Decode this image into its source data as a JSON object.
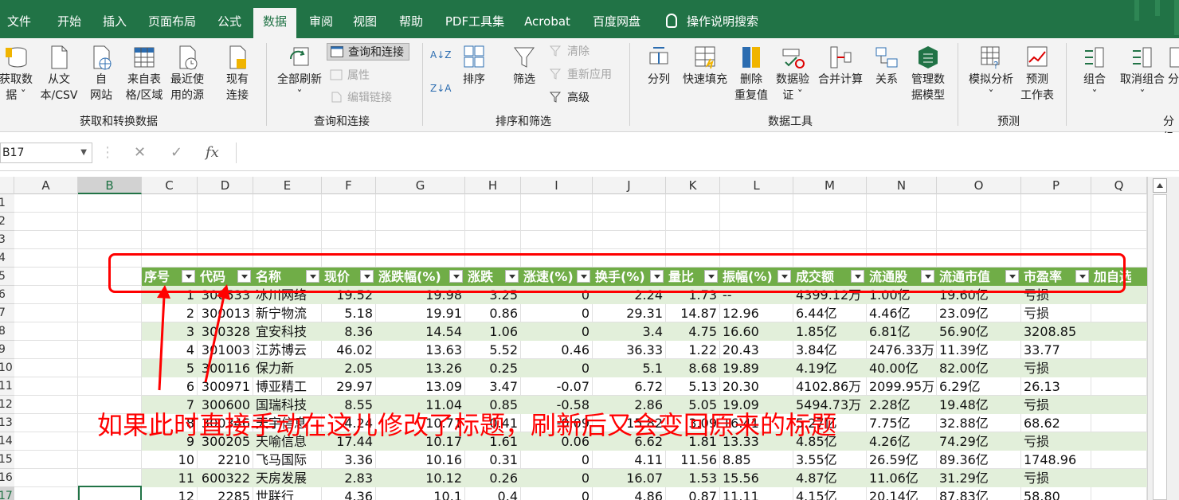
{
  "ribbon_tabs": [
    "文件",
    "开始",
    "插入",
    "页面布局",
    "公式",
    "数据",
    "审阅",
    "视图",
    "帮助",
    "PDF工具集",
    "Acrobat",
    "百度网盘"
  ],
  "active_tab": "数据",
  "tell_me": "操作说明搜索",
  "ribbon": {
    "get_data": "获取数\n据 ˇ",
    "from_text": "从文\n本/CSV",
    "from_web": "自\n网站",
    "from_table": "来自表\n格/区域",
    "recent_sources": "最近使\n用的源",
    "existing_conn": "现有\n连接",
    "group_get": "获取和转换数据",
    "refresh_all": "全部刷新\nˇ",
    "queries_conn": "查询和连接",
    "properties": "属性",
    "edit_links": "编辑链接",
    "group_queries": "查询和连接",
    "sort_az": "A↓Z",
    "sort_za": "Z↓A",
    "sort": "排序",
    "filter": "筛选",
    "clear": "清除",
    "reapply": "重新应用",
    "advanced": "高级",
    "group_sort": "排序和筛选",
    "text_to_columns": "分列",
    "flash_fill": "快速填充",
    "remove_dup": "删除\n重复值",
    "data_validation": "数据验\n证 ˇ",
    "consolidate": "合并计算",
    "relationships": "关系",
    "data_model": "管理数\n据模型",
    "group_tools": "数据工具",
    "what_if": "模拟分析\nˇ",
    "forecast_sheet": "预测\n工作表",
    "group_forecast": "预测",
    "group_btn": "组合\nˇ",
    "ungroup": "取消组合\nˇ",
    "subtotal": "分",
    "group_outline": "分级"
  },
  "formula_bar": {
    "name_box": "B17",
    "fx": "fx",
    "cancel": "✕",
    "enter": "✓"
  },
  "columns": [
    "A",
    "B",
    "C",
    "D",
    "E",
    "F",
    "G",
    "H",
    "I",
    "J",
    "K",
    "L",
    "M",
    "N",
    "O",
    "P",
    "Q"
  ],
  "row_numbers": [
    "1",
    "2",
    "3",
    "4",
    "5",
    "6",
    "7",
    "8",
    "9",
    "10",
    "11",
    "12",
    "13",
    "14",
    "15",
    "16",
    "17"
  ],
  "table": {
    "headers": [
      "序号",
      "代码",
      "名称",
      "现价",
      "涨跌幅(%)",
      "涨跌",
      "涨速(%)",
      "换手(%)",
      "量比",
      "振幅(%)",
      "成交额",
      "流通股",
      "流通市值",
      "市盈率",
      "加自选"
    ],
    "rows": [
      [
        "1",
        "300533",
        "冰川网络",
        "19.52",
        "19.98",
        "3.25",
        "0",
        "2.24",
        "1.73",
        "--",
        "4399.12万",
        "1.00亿",
        "19.60亿",
        "亏损"
      ],
      [
        "2",
        "300013",
        "新宁物流",
        "5.18",
        "19.91",
        "0.86",
        "0",
        "29.31",
        "14.87",
        "12.96",
        "6.44亿",
        "4.46亿",
        "23.09亿",
        "亏损"
      ],
      [
        "3",
        "300328",
        "宜安科技",
        "8.36",
        "14.54",
        "1.06",
        "0",
        "3.4",
        "4.75",
        "16.60",
        "1.85亿",
        "6.81亿",
        "56.90亿",
        "3208.85"
      ],
      [
        "4",
        "301003",
        "江苏博云",
        "46.02",
        "13.63",
        "5.52",
        "0.46",
        "36.33",
        "1.22",
        "20.43",
        "3.84亿",
        "2476.33万",
        "11.39亿",
        "33.77"
      ],
      [
        "5",
        "300116",
        "保力新",
        "2.05",
        "13.26",
        "0.25",
        "0",
        "5.1",
        "8.68",
        "19.89",
        "4.19亿",
        "40.00亿",
        "82.00亿",
        "亏损"
      ],
      [
        "6",
        "300971",
        "博亚精工",
        "29.97",
        "13.09",
        "3.47",
        "-0.07",
        "6.72",
        "5.13",
        "20.30",
        "4102.86万",
        "2099.95万",
        "6.29亿",
        "26.13"
      ],
      [
        "7",
        "300600",
        "国瑞科技",
        "8.55",
        "11.04",
        "0.85",
        "-0.58",
        "2.86",
        "5.05",
        "19.09",
        "5494.73万",
        "2.28亿",
        "19.48亿",
        "亏损"
      ],
      [
        "8",
        "300346",
        "天宇信息",
        "4.24",
        "10.71",
        "0.41",
        "-0.09",
        "15.82",
        "3.09",
        "16.41",
        "5.27亿",
        "7.75亿",
        "32.88亿",
        "68.62"
      ],
      [
        "9",
        "300205",
        "天喻信息",
        "17.44",
        "10.17",
        "1.61",
        "0.06",
        "6.62",
        "1.81",
        "13.33",
        "4.85亿",
        "4.26亿",
        "74.29亿",
        "亏损"
      ],
      [
        "10",
        "2210",
        "飞马国际",
        "3.36",
        "10.16",
        "0.31",
        "0",
        "4.11",
        "11.56",
        "8.85",
        "3.55亿",
        "26.59亿",
        "89.36亿",
        "1748.96"
      ],
      [
        "11",
        "600322",
        "天房发展",
        "2.83",
        "10.12",
        "0.26",
        "0",
        "16.07",
        "1.53",
        "15.56",
        "4.87亿",
        "11.06亿",
        "31.29亿",
        "亏损"
      ],
      [
        "12",
        "2285",
        "世联行",
        "4.36",
        "10.1",
        "0.4",
        "0",
        "4.86",
        "0.87",
        "11.11",
        "4.15亿",
        "20.14亿",
        "87.83亿",
        "58.80"
      ]
    ]
  },
  "annotation": "如果此时直接手动在这儿修改了标题，刷新后又会变回原来的标题",
  "colors": {
    "excel_green": "#217346",
    "table_header": "#70ad47",
    "band": "#e2efda",
    "annotation": "#ff0000"
  }
}
